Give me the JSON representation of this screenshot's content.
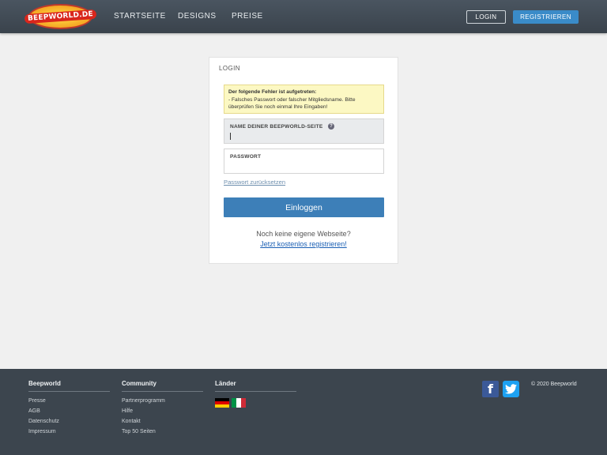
{
  "header": {
    "logo_text": "BEEPWORLD.DE",
    "nav": [
      "STARTSEITE",
      "DESIGNS",
      "PREISE"
    ],
    "login_label": "LOGIN",
    "register_label": "REGISTRIEREN"
  },
  "login": {
    "title": "LOGIN",
    "error_head": "Der folgende Fehler ist aufgetreten:",
    "error_text": "- Falsches Passwort oder falscher Mitgliedsname. Bitte überprüfen Sie noch einmal Ihre Eingaben!",
    "name_label": "NAME DEINER BEEPWORLD-SEITE",
    "help_glyph": "?",
    "password_label": "PASSWORT",
    "reset_link": "Passwort zurücksetzen",
    "submit_label": "Einloggen",
    "no_site_text": "Noch keine eigene Webseite?",
    "register_link": "Jetzt kostenlos registrieren!"
  },
  "footer": {
    "beepworld": {
      "title": "Beepworld",
      "items": [
        "Presse",
        "AGB",
        "Datenschutz",
        "Impressum"
      ]
    },
    "community": {
      "title": "Community",
      "items": [
        "Partnerprogramm",
        "Hilfe",
        "Kontakt",
        "Top 50 Seiten"
      ]
    },
    "countries": {
      "title": "Länder",
      "flags": [
        "germany-flag",
        "italy-flag"
      ]
    },
    "social_icons": [
      "facebook-icon",
      "twitter-icon"
    ],
    "facebook_glyph": "f",
    "copyright": "© 2020 Beepworld"
  },
  "colors": {
    "header_bg": "#3e4852",
    "accent_blue": "#3a8bc8",
    "submit_blue": "#3d7fb8",
    "error_bg": "#fcf8c3",
    "footer_bg": "#3c454e"
  }
}
